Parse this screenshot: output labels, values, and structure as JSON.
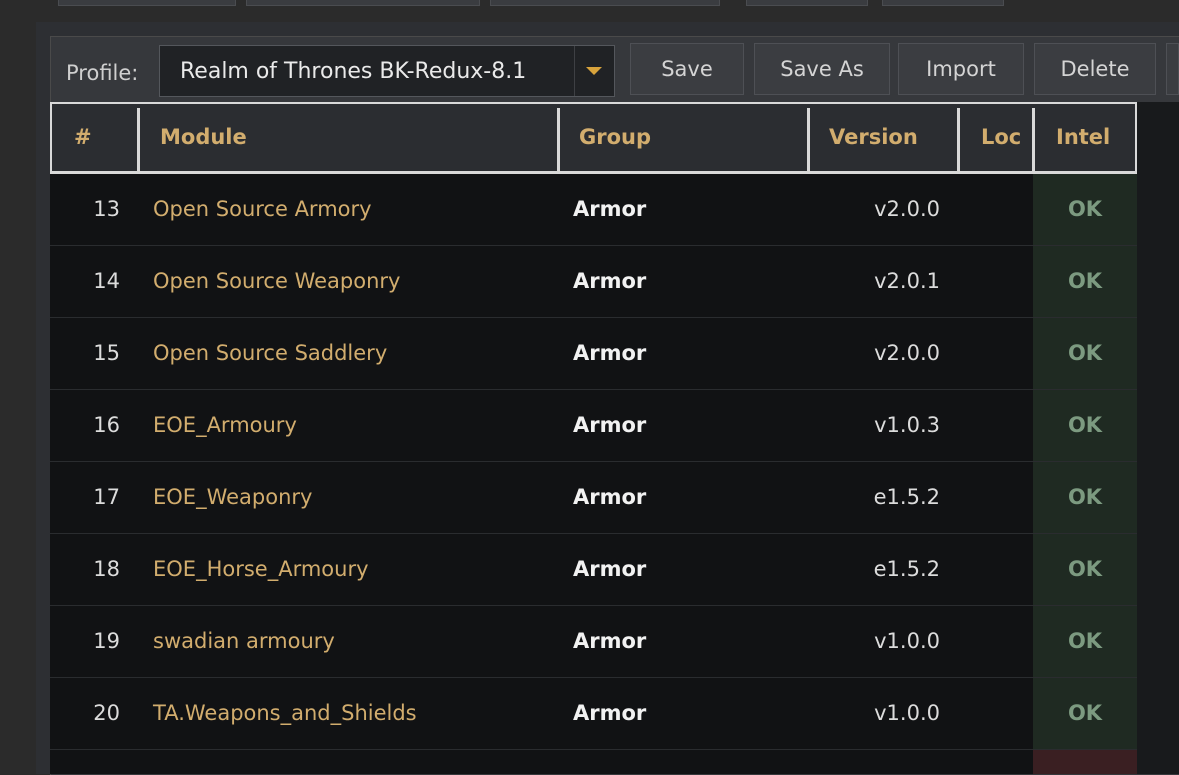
{
  "toolbar": {
    "profile_label": "Profile:",
    "profile_value": "Realm of Thrones BK-Redux-8.1",
    "save": "Save",
    "save_as": "Save As",
    "import": "Import",
    "delete": "Delete"
  },
  "table": {
    "headers": {
      "num": "#",
      "module": "Module",
      "group": "Group",
      "version": "Version",
      "loc": "Loc",
      "intel": "Intel"
    },
    "rows": [
      {
        "num": "13",
        "module": "Open Source Armory",
        "group": "Armor",
        "version": "v2.0.0",
        "intel": "OK"
      },
      {
        "num": "14",
        "module": "Open Source Weaponry",
        "group": "Armor",
        "version": "v2.0.1",
        "intel": "OK"
      },
      {
        "num": "15",
        "module": "Open Source Saddlery",
        "group": "Armor",
        "version": "v2.0.0",
        "intel": "OK"
      },
      {
        "num": "16",
        "module": "EOE_Armoury",
        "group": "Armor",
        "version": "v1.0.3",
        "intel": "OK"
      },
      {
        "num": "17",
        "module": "EOE_Weaponry",
        "group": "Armor",
        "version": "e1.5.2",
        "intel": "OK"
      },
      {
        "num": "18",
        "module": "EOE_Horse_Armoury",
        "group": "Armor",
        "version": "e1.5.2",
        "intel": "OK"
      },
      {
        "num": "19",
        "module": "swadian armoury",
        "group": "Armor",
        "version": "v1.0.0",
        "intel": "OK"
      },
      {
        "num": "20",
        "module": "TA.Weapons_and_Shields",
        "group": "Armor",
        "version": "v1.0.0",
        "intel": "OK"
      }
    ]
  },
  "colors": {
    "accent_gold": "#d2ad6e",
    "ok_bg": "#1f2a22",
    "ok_text": "#7c9a80",
    "error_bg": "#3a1f22"
  },
  "icons": {
    "dropdown": "chevron-down-icon"
  }
}
